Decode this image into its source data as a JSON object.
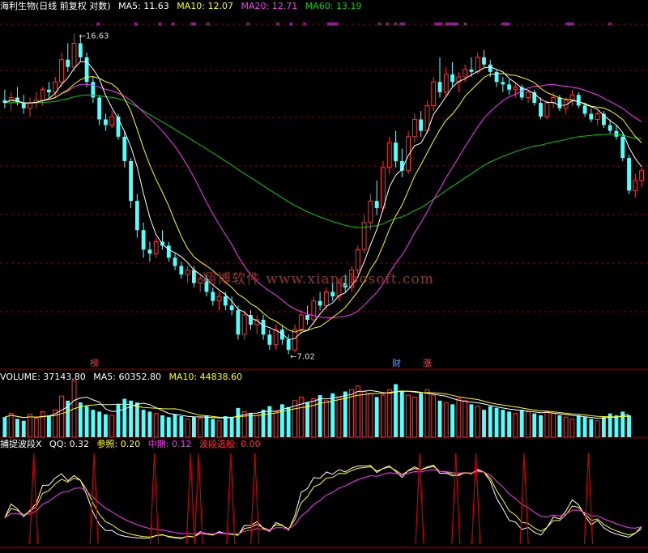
{
  "header": {
    "stock": "海利生物(日线 前复权 对数)",
    "ma5_label": "MA5: 11.63",
    "ma10_label": "MA10: 12.07",
    "ma20_label": "MA20: 12.71",
    "ma60_label": "MA60: 13.19"
  },
  "annotations": {
    "high": "16.63",
    "low": "7.02"
  },
  "watermark": "翔博软件 www.xiangbosoft.com",
  "event_tags": [
    {
      "text": "榜",
      "color": "#e04040"
    },
    {
      "text": "财",
      "color": "#5aa0ff"
    },
    {
      "text": "涨",
      "color": "#ff5050"
    }
  ],
  "volume_header": {
    "volume_label": "VOLUME: 37143.80",
    "ma5_label": "MA5: 60352.80",
    "ma10_label": "MA10: 44838.60"
  },
  "indicator_header": {
    "name": "捕捉波段X",
    "qq_label": "QQ: 0.32",
    "ref_label": "参照: 0.20",
    "mid_label": "中期: 0.12",
    "band_label": "波段选股: 0.00"
  },
  "colors": {
    "up": "#ff3232",
    "down": "#54ffff",
    "ma5": "#ffffff",
    "ma10": "#ffff00",
    "ma20": "#ff33ff",
    "ma60": "#00cc00",
    "grid": "#8b0000",
    "border": "#a00000",
    "marker": "#ff33ff"
  },
  "chart_data": {
    "type": "candlestick",
    "price_axis": "log",
    "price_range": [
      6.8,
      17.5
    ],
    "candles": [
      {
        "o": 13.9,
        "h": 14.3,
        "l": 13.6,
        "c": 13.8
      },
      {
        "o": 13.8,
        "h": 14.2,
        "l": 13.5,
        "c": 14.0
      },
      {
        "o": 14.0,
        "h": 14.4,
        "l": 13.7,
        "c": 13.8
      },
      {
        "o": 13.8,
        "h": 14.1,
        "l": 13.4,
        "c": 13.6
      },
      {
        "o": 13.6,
        "h": 14.0,
        "l": 13.3,
        "c": 13.8
      },
      {
        "o": 13.8,
        "h": 14.2,
        "l": 13.6,
        "c": 13.9
      },
      {
        "o": 13.9,
        "h": 14.4,
        "l": 13.7,
        "c": 14.3
      },
      {
        "o": 14.3,
        "h": 14.6,
        "l": 14.0,
        "c": 14.2
      },
      {
        "o": 14.2,
        "h": 14.8,
        "l": 14.0,
        "c": 14.6
      },
      {
        "o": 14.6,
        "h": 15.8,
        "l": 14.4,
        "c": 15.5
      },
      {
        "o": 15.5,
        "h": 16.2,
        "l": 15.0,
        "c": 15.2
      },
      {
        "o": 15.2,
        "h": 16.63,
        "l": 15.0,
        "c": 16.2
      },
      {
        "o": 16.2,
        "h": 16.5,
        "l": 15.4,
        "c": 15.6
      },
      {
        "o": 15.6,
        "h": 15.8,
        "l": 14.4,
        "c": 14.6
      },
      {
        "o": 14.6,
        "h": 14.8,
        "l": 13.8,
        "c": 14.0
      },
      {
        "o": 14.0,
        "h": 14.1,
        "l": 13.0,
        "c": 13.2
      },
      {
        "o": 13.2,
        "h": 13.4,
        "l": 12.8,
        "c": 13.0
      },
      {
        "o": 13.0,
        "h": 13.5,
        "l": 12.9,
        "c": 13.3
      },
      {
        "o": 13.3,
        "h": 13.4,
        "l": 12.5,
        "c": 12.6
      },
      {
        "o": 12.6,
        "h": 12.8,
        "l": 11.6,
        "c": 11.8
      },
      {
        "o": 11.8,
        "h": 11.9,
        "l": 10.4,
        "c": 10.6
      },
      {
        "o": 10.6,
        "h": 10.8,
        "l": 9.6,
        "c": 9.8
      },
      {
        "o": 9.8,
        "h": 10.0,
        "l": 9.1,
        "c": 9.3
      },
      {
        "o": 9.3,
        "h": 9.5,
        "l": 9.0,
        "c": 9.2
      },
      {
        "o": 9.2,
        "h": 9.6,
        "l": 9.1,
        "c": 9.5
      },
      {
        "o": 9.5,
        "h": 9.8,
        "l": 9.3,
        "c": 9.4
      },
      {
        "o": 9.4,
        "h": 9.5,
        "l": 9.0,
        "c": 9.1
      },
      {
        "o": 9.1,
        "h": 9.2,
        "l": 8.8,
        "c": 8.9
      },
      {
        "o": 8.9,
        "h": 9.0,
        "l": 8.6,
        "c": 8.7
      },
      {
        "o": 8.7,
        "h": 8.9,
        "l": 8.5,
        "c": 8.8
      },
      {
        "o": 8.8,
        "h": 8.9,
        "l": 8.4,
        "c": 8.5
      },
      {
        "o": 8.5,
        "h": 8.7,
        "l": 8.3,
        "c": 8.6
      },
      {
        "o": 8.6,
        "h": 8.7,
        "l": 8.2,
        "c": 8.3
      },
      {
        "o": 8.3,
        "h": 8.4,
        "l": 8.0,
        "c": 8.1
      },
      {
        "o": 8.1,
        "h": 8.3,
        "l": 7.9,
        "c": 8.2
      },
      {
        "o": 8.2,
        "h": 8.3,
        "l": 7.9,
        "c": 8.0
      },
      {
        "o": 8.0,
        "h": 8.2,
        "l": 7.8,
        "c": 7.9
      },
      {
        "o": 7.9,
        "h": 8.0,
        "l": 7.3,
        "c": 7.4
      },
      {
        "o": 7.4,
        "h": 7.9,
        "l": 7.3,
        "c": 7.8
      },
      {
        "o": 7.8,
        "h": 7.9,
        "l": 7.5,
        "c": 7.6
      },
      {
        "o": 7.6,
        "h": 7.8,
        "l": 7.4,
        "c": 7.7
      },
      {
        "o": 7.7,
        "h": 7.8,
        "l": 7.3,
        "c": 7.4
      },
      {
        "o": 7.4,
        "h": 7.5,
        "l": 7.1,
        "c": 7.2
      },
      {
        "o": 7.2,
        "h": 7.6,
        "l": 7.1,
        "c": 7.5
      },
      {
        "o": 7.5,
        "h": 7.6,
        "l": 7.2,
        "c": 7.3
      },
      {
        "o": 7.3,
        "h": 7.4,
        "l": 7.02,
        "c": 7.1
      },
      {
        "o": 7.1,
        "h": 7.6,
        "l": 7.05,
        "c": 7.5
      },
      {
        "o": 7.5,
        "h": 7.9,
        "l": 7.4,
        "c": 7.8
      },
      {
        "o": 7.8,
        "h": 8.0,
        "l": 7.6,
        "c": 7.7
      },
      {
        "o": 7.7,
        "h": 8.2,
        "l": 7.6,
        "c": 8.1
      },
      {
        "o": 8.1,
        "h": 8.3,
        "l": 7.9,
        "c": 8.0
      },
      {
        "o": 8.0,
        "h": 8.4,
        "l": 7.9,
        "c": 8.3
      },
      {
        "o": 8.3,
        "h": 8.5,
        "l": 8.1,
        "c": 8.2
      },
      {
        "o": 8.2,
        "h": 8.6,
        "l": 8.1,
        "c": 8.5
      },
      {
        "o": 8.5,
        "h": 8.7,
        "l": 8.3,
        "c": 8.4
      },
      {
        "o": 8.4,
        "h": 8.9,
        "l": 8.3,
        "c": 8.8
      },
      {
        "o": 8.8,
        "h": 9.4,
        "l": 8.7,
        "c": 9.3
      },
      {
        "o": 9.3,
        "h": 10.2,
        "l": 9.2,
        "c": 10.0
      },
      {
        "o": 10.0,
        "h": 10.8,
        "l": 9.8,
        "c": 10.6
      },
      {
        "o": 10.6,
        "h": 11.2,
        "l": 10.2,
        "c": 10.4
      },
      {
        "o": 10.4,
        "h": 11.8,
        "l": 10.3,
        "c": 11.6
      },
      {
        "o": 11.6,
        "h": 12.6,
        "l": 11.4,
        "c": 12.4
      },
      {
        "o": 12.4,
        "h": 12.8,
        "l": 11.6,
        "c": 11.8
      },
      {
        "o": 11.8,
        "h": 12.2,
        "l": 11.3,
        "c": 11.5
      },
      {
        "o": 11.5,
        "h": 12.8,
        "l": 11.4,
        "c": 12.6
      },
      {
        "o": 12.6,
        "h": 13.4,
        "l": 12.4,
        "c": 13.2
      },
      {
        "o": 13.2,
        "h": 13.5,
        "l": 12.6,
        "c": 12.8
      },
      {
        "o": 12.8,
        "h": 13.9,
        "l": 12.7,
        "c": 13.7
      },
      {
        "o": 13.7,
        "h": 14.8,
        "l": 13.5,
        "c": 14.6
      },
      {
        "o": 14.6,
        "h": 15.6,
        "l": 14.0,
        "c": 14.2
      },
      {
        "o": 14.2,
        "h": 15.2,
        "l": 14.0,
        "c": 14.9
      },
      {
        "o": 14.9,
        "h": 15.4,
        "l": 14.4,
        "c": 14.6
      },
      {
        "o": 14.6,
        "h": 15.0,
        "l": 14.2,
        "c": 14.8
      },
      {
        "o": 14.8,
        "h": 15.3,
        "l": 14.6,
        "c": 15.1
      },
      {
        "o": 15.1,
        "h": 15.6,
        "l": 14.8,
        "c": 15.0
      },
      {
        "o": 15.0,
        "h": 15.8,
        "l": 14.9,
        "c": 15.6
      },
      {
        "o": 15.6,
        "h": 15.9,
        "l": 15.2,
        "c": 15.3
      },
      {
        "o": 15.3,
        "h": 15.5,
        "l": 14.8,
        "c": 15.0
      },
      {
        "o": 15.0,
        "h": 15.1,
        "l": 14.4,
        "c": 14.6
      },
      {
        "o": 14.6,
        "h": 14.8,
        "l": 14.2,
        "c": 14.5
      },
      {
        "o": 14.5,
        "h": 14.7,
        "l": 14.1,
        "c": 14.3
      },
      {
        "o": 14.3,
        "h": 14.6,
        "l": 14.0,
        "c": 14.4
      },
      {
        "o": 14.4,
        "h": 14.5,
        "l": 13.9,
        "c": 14.0
      },
      {
        "o": 14.0,
        "h": 14.3,
        "l": 13.8,
        "c": 14.2
      },
      {
        "o": 14.2,
        "h": 14.3,
        "l": 13.7,
        "c": 13.8
      },
      {
        "o": 13.8,
        "h": 14.0,
        "l": 13.2,
        "c": 13.3
      },
      {
        "o": 13.3,
        "h": 13.9,
        "l": 13.2,
        "c": 13.8
      },
      {
        "o": 13.8,
        "h": 14.2,
        "l": 13.6,
        "c": 14.0
      },
      {
        "o": 14.0,
        "h": 14.1,
        "l": 13.5,
        "c": 13.6
      },
      {
        "o": 13.6,
        "h": 14.0,
        "l": 13.4,
        "c": 13.9
      },
      {
        "o": 13.9,
        "h": 14.3,
        "l": 13.7,
        "c": 14.1
      },
      {
        "o": 14.1,
        "h": 14.2,
        "l": 13.6,
        "c": 13.7
      },
      {
        "o": 13.7,
        "h": 13.8,
        "l": 13.3,
        "c": 13.4
      },
      {
        "o": 13.4,
        "h": 13.6,
        "l": 13.1,
        "c": 13.2
      },
      {
        "o": 13.2,
        "h": 13.5,
        "l": 13.0,
        "c": 13.4
      },
      {
        "o": 13.4,
        "h": 13.5,
        "l": 12.9,
        "c": 13.0
      },
      {
        "o": 13.0,
        "h": 13.2,
        "l": 12.7,
        "c": 12.8
      },
      {
        "o": 12.8,
        "h": 13.0,
        "l": 12.5,
        "c": 12.6
      },
      {
        "o": 12.6,
        "h": 12.7,
        "l": 11.8,
        "c": 11.9
      },
      {
        "o": 11.9,
        "h": 12.0,
        "l": 10.8,
        "c": 10.9
      },
      {
        "o": 10.9,
        "h": 11.4,
        "l": 10.7,
        "c": 11.2
      },
      {
        "o": 11.2,
        "h": 11.6,
        "l": 11.0,
        "c": 11.5
      }
    ],
    "volume": [
      22,
      26,
      20,
      18,
      25,
      21,
      28,
      24,
      30,
      45,
      40,
      62,
      38,
      34,
      30,
      28,
      25,
      24,
      36,
      42,
      40,
      38,
      30,
      28,
      26,
      24,
      22,
      25,
      23,
      20,
      22,
      21,
      24,
      20,
      18,
      23,
      22,
      32,
      28,
      26,
      24,
      30,
      34,
      28,
      36,
      33,
      40,
      44,
      38,
      42,
      46,
      40,
      48,
      44,
      50,
      52,
      56,
      50,
      48,
      44,
      46,
      52,
      58,
      50,
      46,
      44,
      48,
      52,
      46,
      40,
      38,
      36,
      42,
      40,
      36,
      34,
      30,
      34,
      32,
      30,
      28,
      26,
      30,
      28,
      26,
      24,
      28,
      26,
      24,
      22,
      20,
      24,
      22,
      20,
      18,
      22,
      26,
      24,
      28,
      24
    ],
    "signals": [
      35,
      49,
      58,
      63,
      70,
      71,
      76,
      91,
      102,
      107,
      112,
      121,
      122,
      123,
      124,
      140,
      143,
      146,
      148,
      149,
      161,
      162,
      163,
      165,
      166,
      167,
      168,
      169,
      172,
      186,
      187,
      188,
      210,
      211,
      212,
      226
    ],
    "pulses": [
      8,
      23,
      38,
      47,
      49,
      57,
      63,
      104,
      113,
      118,
      130,
      146
    ],
    "legend": [
      {
        "name": "MA5",
        "value": "11.63"
      },
      {
        "name": "MA10",
        "value": "12.07"
      },
      {
        "name": "MA20",
        "value": "12.71"
      },
      {
        "name": "MA60",
        "value": "13.19"
      }
    ]
  }
}
